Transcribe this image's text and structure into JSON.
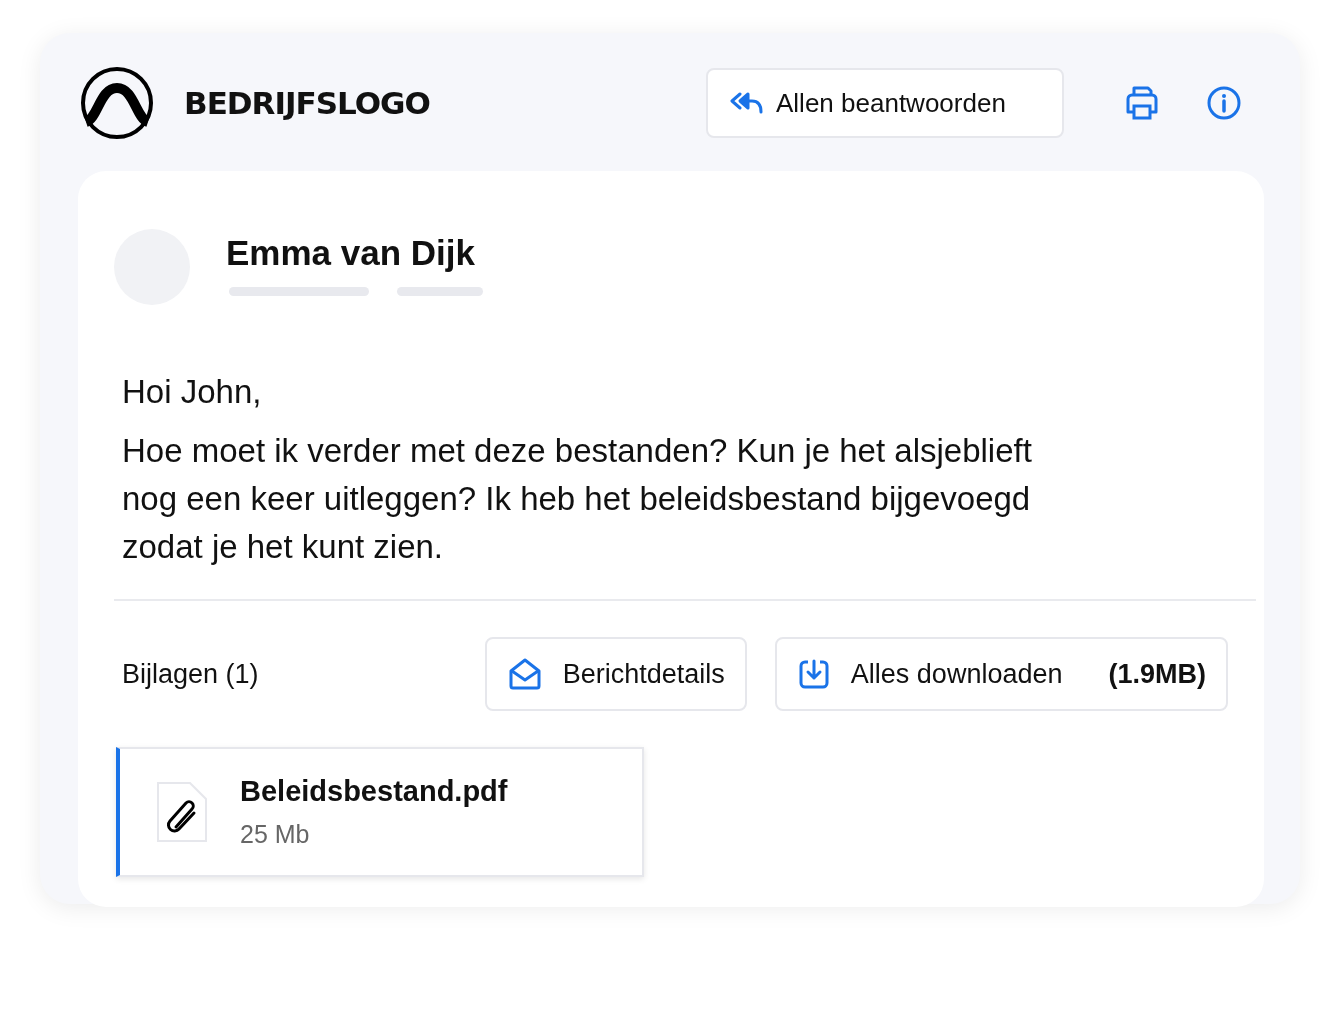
{
  "header": {
    "logo_text": "BEDRIJFSLOGO",
    "reply_all_button": "Allen beantwoorden"
  },
  "message": {
    "sender": "Emma van Dijk",
    "greeting": "Hoi John,",
    "body": "Hoe moet ik verder met deze bestanden? Kun je het alsjeblieft nog een keer uitleggen? Ik heb het beleidsbestand bijgevoegd zodat je het kunt zien."
  },
  "attachments_bar": {
    "label": "Bijlagen (1)",
    "details_button": "Berichtdetails",
    "download_button": {
      "label": "Alles downloaden",
      "size": "(1.9MB)"
    }
  },
  "attachments": [
    {
      "name": "Beleidsbestand.pdf",
      "size": "25 Mb",
      "selected": true
    }
  ]
}
